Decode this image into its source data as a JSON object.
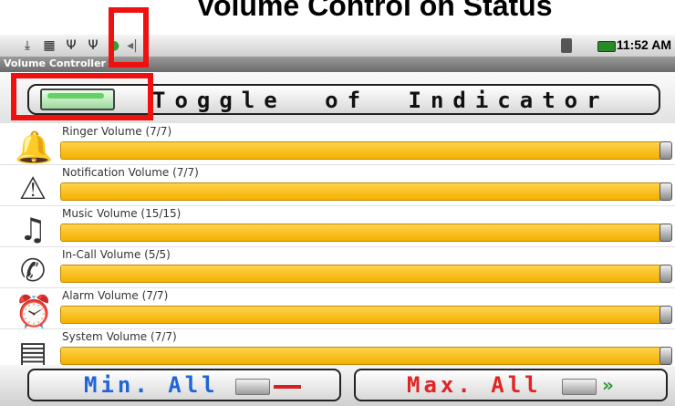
{
  "headline": "Volume Control on Status",
  "statusbar": {
    "time": "11:52 AM",
    "icons": [
      "download-icon",
      "save-icon",
      "usb-icon",
      "usb-icon",
      "android-icon",
      "volume-indicator-icon"
    ]
  },
  "app": {
    "title": "Volume Controller",
    "toggle_label": "Toggle of Indicator"
  },
  "volumes": [
    {
      "label": "Ringer Volume (7/7)",
      "icon": "bell-icon",
      "fraction": 1.0
    },
    {
      "label": "Notification Volume (7/7)",
      "icon": "warning-icon",
      "fraction": 1.0
    },
    {
      "label": "Music Volume (15/15)",
      "icon": "music-icon",
      "fraction": 1.0
    },
    {
      "label": "In-Call Volume (5/5)",
      "icon": "phone-icon",
      "fraction": 1.0
    },
    {
      "label": "Alarm Volume (7/7)",
      "icon": "alarm-clock-icon",
      "fraction": 1.0
    },
    {
      "label": "System Volume (7/7)",
      "icon": "system-phone-icon",
      "fraction": 1.0
    }
  ],
  "buttons": {
    "min_label": "Min. All",
    "max_label": "Max. All"
  },
  "colors": {
    "highlight": "#ef1010",
    "slider": "#f7b800",
    "min_text": "#1f64d9",
    "max_text": "#e12424"
  }
}
